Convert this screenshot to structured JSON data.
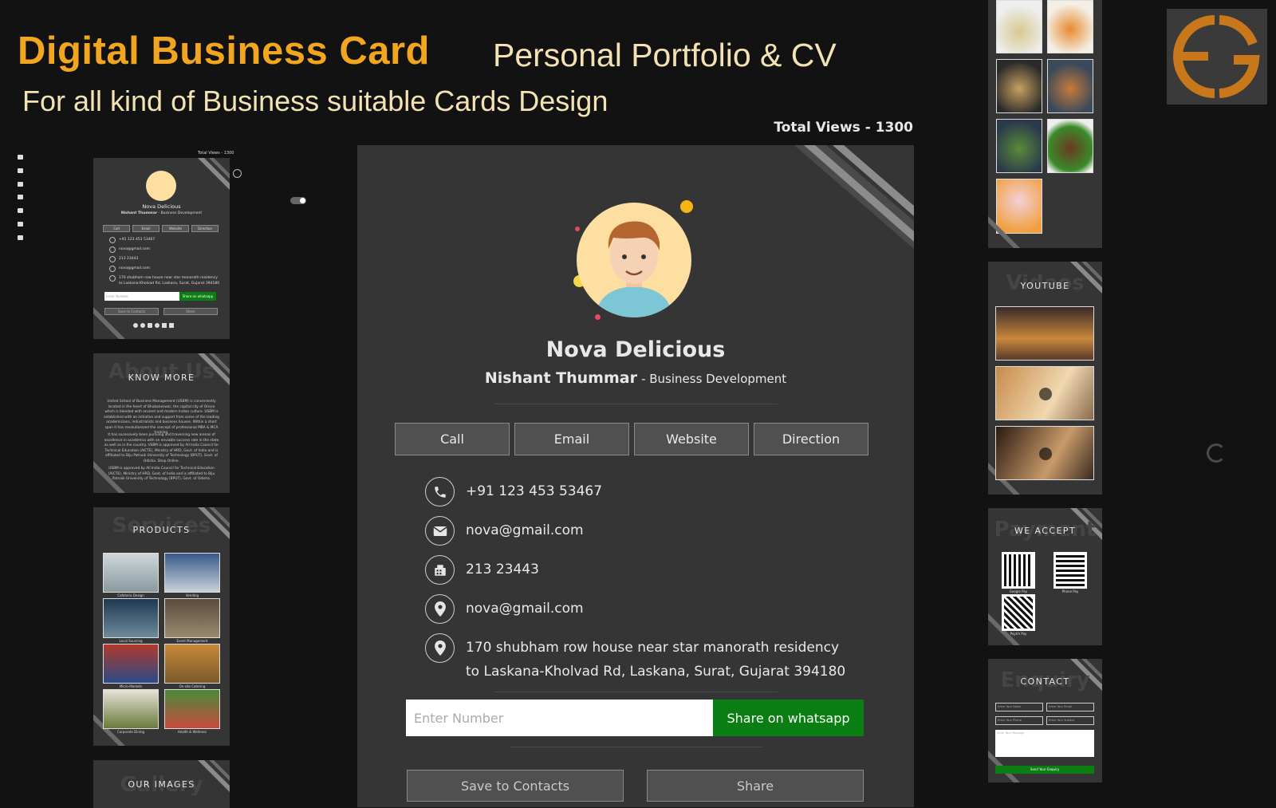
{
  "header": {
    "title": "Digital Business Card",
    "subtitle": "Personal Portfolio & CV",
    "tagline": "For all kind of Business suitable Cards Design"
  },
  "main_card": {
    "total_views": "Total Views - 1300",
    "business_name": "Nova Delicious",
    "person_name": "Nishant Thummar",
    "role": "- Business Development",
    "buttons": [
      "Call",
      "Email",
      "Website",
      "Direction"
    ],
    "contacts": [
      {
        "icon": "phone-icon",
        "text": "+91 123 453 53467"
      },
      {
        "icon": "envelope-icon",
        "text": "nova@gmail.com"
      },
      {
        "icon": "fax-icon",
        "text": "213 23443"
      },
      {
        "icon": "map-pin-icon",
        "text": "nova@gmail.com"
      },
      {
        "icon": "map-pin-icon",
        "text": "170 shubham row house near star manorath residency",
        "text2": "to Laskana-Kholvad Rd, Laskana, Surat, Gujarat 394180"
      }
    ],
    "share": {
      "placeholder": "Enter Number",
      "button": "Share on whatsapp"
    },
    "save_contacts": "Save to Contacts",
    "share_button": "Share"
  },
  "mini_card": {
    "total_views": "Total Views - 1300",
    "business_name": "Nova Delicious",
    "person_name": "Nishant Thummar",
    "role": "- Business Development",
    "buttons": [
      "Call",
      "Email",
      "Website",
      "Direction"
    ],
    "contacts": [
      "+91 123 453 53467",
      "nova@gmail.com",
      "213 23443",
      "nova@gmail.com",
      "170 shubham row house near star manorath residency",
      "to Laskana-Kholvad Rd, Laskana, Surat, Gujarat 394180"
    ],
    "placeholder": "Enter Number",
    "whatsapp": "Share on whatsapp",
    "save": "Save to Contacts",
    "share": "Share"
  },
  "know_more": {
    "title": "KNOW MORE",
    "ghost": "About Us",
    "p1": "United School of Business Management (USBM) is conveniently located in the heart of Bhubaneswar, the capital city of Orissa which is blended with ancient and modern Indian culture. USBM is established with an initiative and support from some of the leading academicians, industrialists and business houses. Within a short span it has revolutionized the concept of professional MBA & MCA training.",
    "p2": "It has sucessively been pursuing and traversing new arenas of excellence in academics with an enviable success rate in the state as well as in the country. USBM is approved by All India Council for Technical Education (AICTE), Ministry of HRD, Govt. of India and is affiliated to Biju Patnaik University of Technology (BPUT), Govt. of Odisha. Shop Online.",
    "p3": "USBM is approved by All India Council for Technical Education (AICTE), Ministry of HRD, Govt. of India and is affiliated to Biju Patnaik University of Technology (BPUT), Govt. of Odisha."
  },
  "products": {
    "title": "PRODUCTS",
    "ghost": "Services",
    "items": [
      "Cafeteria Design",
      "Vending",
      "Local Sourcing",
      "Event Management",
      "Micro-Markets",
      "On-site Catering",
      "Corporate Dining",
      "Health & Wellness"
    ]
  },
  "our_images": {
    "title": "OUR IMAGES",
    "ghost": "Gallery"
  },
  "youtube": {
    "title": "YOUTUBE",
    "ghost": "Videos"
  },
  "we_accept": {
    "title": "WE ACCEPT",
    "ghost": "Payment",
    "labels": [
      "Google Pay",
      "Phone Pay",
      "Paytm Pay"
    ]
  },
  "contact": {
    "title": "CONTACT",
    "ghost": "Enquiry",
    "fields": [
      "Enter Your Name",
      "Enter Your Email",
      "Enter Your Phone",
      "Enter Your Subject",
      "Enter Your Message"
    ],
    "submit": "Send Your Enquiry"
  },
  "colors": {
    "accent": "#f2a51e",
    "cream": "#f3e2b4",
    "card": "#353535",
    "whatsapp": "#0a7e12"
  }
}
